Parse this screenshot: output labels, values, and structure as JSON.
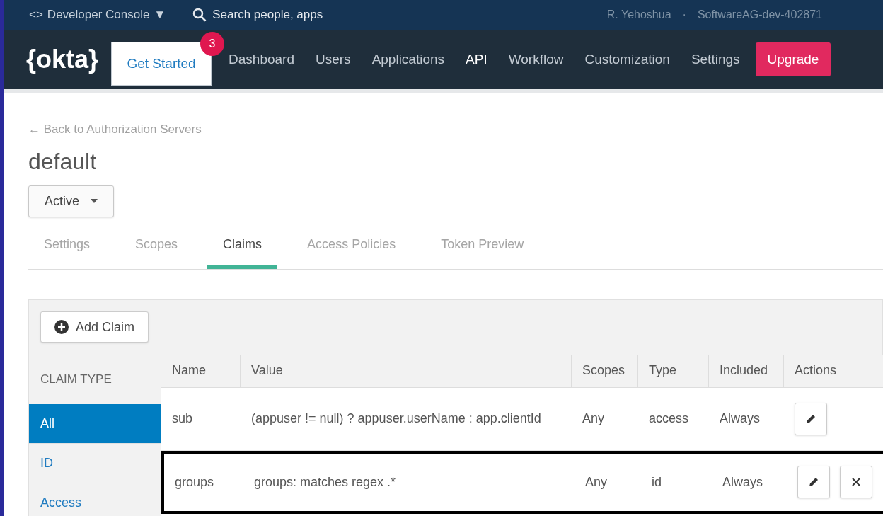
{
  "top_bar": {
    "console_menu": {
      "icon": "<>",
      "label": "Developer Console",
      "caret": "▼"
    },
    "search": {
      "placeholder": "Search people, apps"
    },
    "user": "R. Yehoshua",
    "separator": "·",
    "org": "SoftwareAG-dev-402871"
  },
  "nav": {
    "logo": "{okta}",
    "get_started": {
      "label": "Get Started",
      "badge": "3"
    },
    "items": [
      {
        "label": "Dashboard",
        "selected": false
      },
      {
        "label": "Users",
        "selected": false
      },
      {
        "label": "Applications",
        "selected": false
      },
      {
        "label": "API",
        "selected": true
      },
      {
        "label": "Workflow",
        "selected": false
      },
      {
        "label": "Customization",
        "selected": false
      },
      {
        "label": "Settings",
        "selected": false
      }
    ],
    "upgrade": "Upgrade"
  },
  "back_link": "← Back to Authorization Servers",
  "title": "default",
  "status_dropdown": "Active",
  "tabs": [
    {
      "label": "Settings",
      "selected": false
    },
    {
      "label": "Scopes",
      "selected": false
    },
    {
      "label": "Claims",
      "selected": true
    },
    {
      "label": "Access Policies",
      "selected": false
    },
    {
      "label": "Token Preview",
      "selected": false
    }
  ],
  "add_claim": "Add Claim",
  "claim_type": {
    "heading": "CLAIM TYPE",
    "items": [
      {
        "label": "All",
        "selected": true
      },
      {
        "label": "ID",
        "selected": false
      },
      {
        "label": "Access",
        "selected": false
      }
    ]
  },
  "table": {
    "columns": [
      "Name",
      "Value",
      "Scopes",
      "Type",
      "Included",
      "Actions"
    ],
    "rows": [
      {
        "cells": [
          "sub",
          "(appuser != null) ? appuser.userName : app.clientId",
          "Any",
          "access",
          "Always"
        ],
        "actions": [
          {
            "kind": "edit"
          }
        ],
        "highlighted": false
      },
      {
        "cells": [
          "groups",
          "groups: matches regex .*",
          "Any",
          "id",
          "Always"
        ],
        "actions": [
          {
            "kind": "edit"
          },
          {
            "kind": "delete"
          }
        ],
        "highlighted": true
      }
    ]
  }
}
